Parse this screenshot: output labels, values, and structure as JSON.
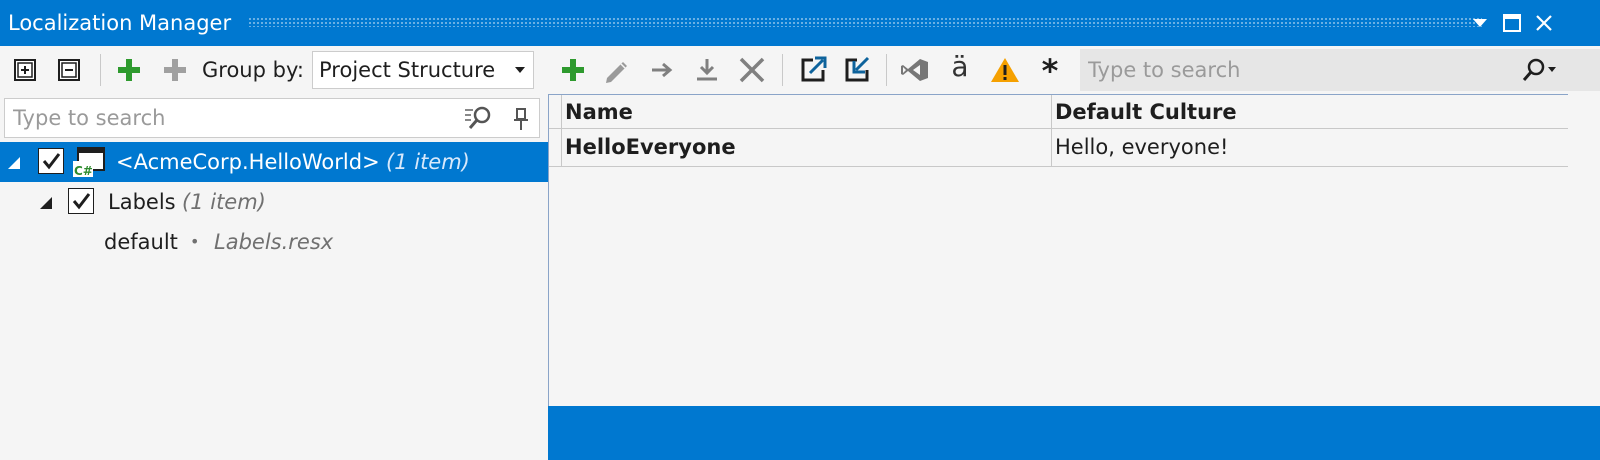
{
  "window": {
    "title": "Localization Manager"
  },
  "left_toolbar": {
    "group_by_label": "Group by:",
    "group_by_value": "Project Structure"
  },
  "left_search": {
    "placeholder": "Type to search"
  },
  "tree": {
    "project": {
      "name": "<AcmeCorp.HelloWorld>",
      "count": "(1 item)",
      "icon_badge": "C#"
    },
    "folder": {
      "name": "Labels",
      "count": "(1 item)"
    },
    "file": {
      "culture": "default",
      "separator": "•",
      "filename": "Labels.resx"
    }
  },
  "right_search": {
    "placeholder": "Type to search"
  },
  "grid": {
    "columns": [
      "Name",
      "Default Culture"
    ],
    "rows": [
      {
        "name": "HelloEveryone",
        "default_culture": "Hello, everyone!"
      }
    ]
  },
  "toolbar_glyphs": {
    "language": "ä",
    "asterisk": "*"
  },
  "colors": {
    "accent": "#0078d0",
    "add_green": "#2e9a2e",
    "warning": "#f5a000",
    "vs_purple": "#68217a"
  }
}
